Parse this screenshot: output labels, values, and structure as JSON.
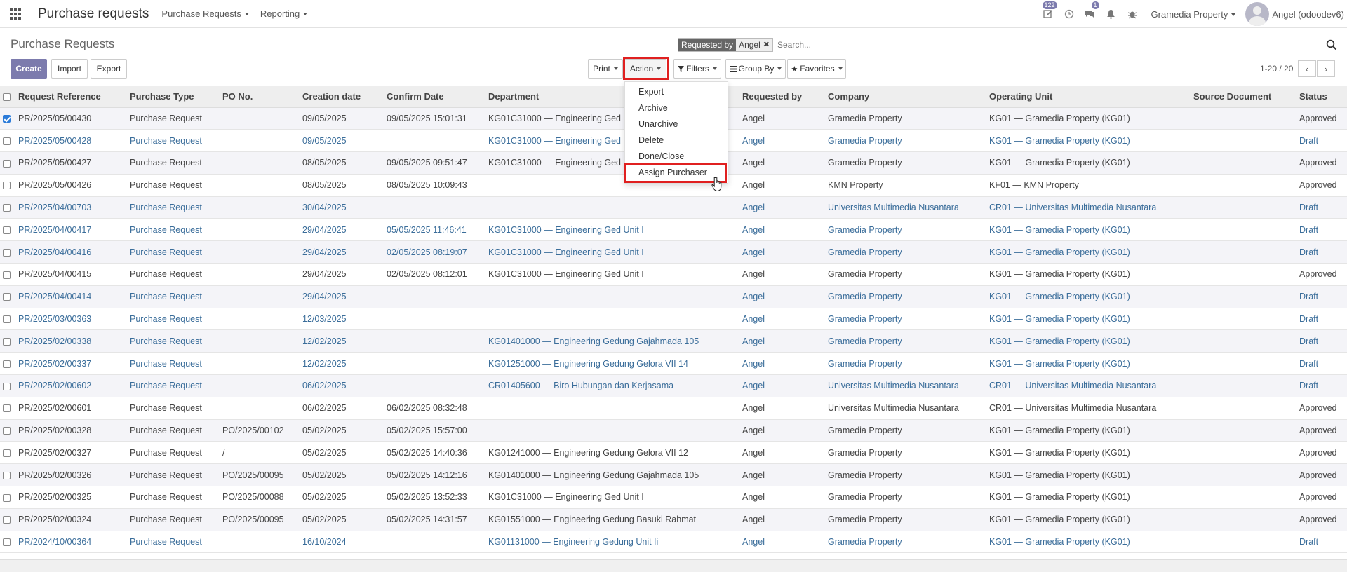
{
  "navbar": {
    "title": "Purchase requests",
    "menus": [
      "Purchase Requests",
      "Reporting"
    ],
    "activity_badge": "122",
    "messages_badge": "1",
    "company": "Gramedia Property",
    "user": "Angel (odoodev6)"
  },
  "control_panel": {
    "title": "Purchase Requests",
    "create_label": "Create",
    "import_label": "Import",
    "export_label": "Export",
    "print_label": "Print",
    "action_label": "Action",
    "filters_label": "Filters",
    "group_by_label": "Group By",
    "favorites_label": "Favorites",
    "search_facet_label": "Requested by",
    "search_facet_value": "Angel",
    "search_placeholder": "Search...",
    "pager": "1-20 / 20"
  },
  "action_menu": [
    "Export",
    "Archive",
    "Unarchive",
    "Delete",
    "Done/Close",
    "Assign Purchaser"
  ],
  "table": {
    "columns": [
      "Request Reference",
      "Purchase Type",
      "PO No.",
      "Creation date",
      "Confirm Date",
      "Department",
      "Requested by",
      "Company",
      "Operating Unit",
      "Source Document",
      "Status"
    ],
    "rows": [
      {
        "checked": true,
        "status_class": "approved",
        "cells": [
          "PR/2025/05/00430",
          "Purchase Request",
          "",
          "09/05/2025",
          "09/05/2025 15:01:31",
          "KG01C31000 — Engineering Ged Unit I",
          "Angel",
          "Gramedia Property",
          "KG01 — Gramedia Property (KG01)",
          "",
          "Approved"
        ]
      },
      {
        "checked": false,
        "status_class": "draft",
        "cells": [
          "PR/2025/05/00428",
          "Purchase Request",
          "",
          "09/05/2025",
          "",
          "KG01C31000 — Engineering Ged Unit I",
          "Angel",
          "Gramedia Property",
          "KG01 — Gramedia Property (KG01)",
          "",
          "Draft"
        ]
      },
      {
        "checked": false,
        "status_class": "approved",
        "cells": [
          "PR/2025/05/00427",
          "Purchase Request",
          "",
          "08/05/2025",
          "09/05/2025 09:51:47",
          "KG01C31000 — Engineering Ged Unit I",
          "Angel",
          "Gramedia Property",
          "KG01 — Gramedia Property (KG01)",
          "",
          "Approved"
        ]
      },
      {
        "checked": false,
        "status_class": "approved",
        "cells": [
          "PR/2025/05/00426",
          "Purchase Request",
          "",
          "08/05/2025",
          "08/05/2025 10:09:43",
          "",
          "Angel",
          "KMN Property",
          "KF01 — KMN Property",
          "",
          "Approved"
        ]
      },
      {
        "checked": false,
        "status_class": "draft",
        "cells": [
          "PR/2025/04/00703",
          "Purchase Request",
          "",
          "30/04/2025",
          "",
          "",
          "Angel",
          "Universitas Multimedia Nusantara",
          "CR01 — Universitas Multimedia Nusantara",
          "",
          "Draft"
        ]
      },
      {
        "checked": false,
        "status_class": "draft",
        "cells": [
          "PR/2025/04/00417",
          "Purchase Request",
          "",
          "29/04/2025",
          "05/05/2025 11:46:41",
          "KG01C31000 — Engineering Ged Unit I",
          "Angel",
          "Gramedia Property",
          "KG01 — Gramedia Property (KG01)",
          "",
          "Draft"
        ]
      },
      {
        "checked": false,
        "status_class": "draft",
        "cells": [
          "PR/2025/04/00416",
          "Purchase Request",
          "",
          "29/04/2025",
          "02/05/2025 08:19:07",
          "KG01C31000 — Engineering Ged Unit I",
          "Angel",
          "Gramedia Property",
          "KG01 — Gramedia Property (KG01)",
          "",
          "Draft"
        ]
      },
      {
        "checked": false,
        "status_class": "approved",
        "cells": [
          "PR/2025/04/00415",
          "Purchase Request",
          "",
          "29/04/2025",
          "02/05/2025 08:12:01",
          "KG01C31000 — Engineering Ged Unit I",
          "Angel",
          "Gramedia Property",
          "KG01 — Gramedia Property (KG01)",
          "",
          "Approved"
        ]
      },
      {
        "checked": false,
        "status_class": "draft",
        "cells": [
          "PR/2025/04/00414",
          "Purchase Request",
          "",
          "29/04/2025",
          "",
          "",
          "Angel",
          "Gramedia Property",
          "KG01 — Gramedia Property (KG01)",
          "",
          "Draft"
        ]
      },
      {
        "checked": false,
        "status_class": "draft",
        "cells": [
          "PR/2025/03/00363",
          "Purchase Request",
          "",
          "12/03/2025",
          "",
          "",
          "Angel",
          "Gramedia Property",
          "KG01 — Gramedia Property (KG01)",
          "",
          "Draft"
        ]
      },
      {
        "checked": false,
        "status_class": "draft",
        "cells": [
          "PR/2025/02/00338",
          "Purchase Request",
          "",
          "12/02/2025",
          "",
          "KG01401000 — Engineering Gedung Gajahmada 105",
          "Angel",
          "Gramedia Property",
          "KG01 — Gramedia Property (KG01)",
          "",
          "Draft"
        ]
      },
      {
        "checked": false,
        "status_class": "draft",
        "cells": [
          "PR/2025/02/00337",
          "Purchase Request",
          "",
          "12/02/2025",
          "",
          "KG01251000 — Engineering Gedung Gelora VII 14",
          "Angel",
          "Gramedia Property",
          "KG01 — Gramedia Property (KG01)",
          "",
          "Draft"
        ]
      },
      {
        "checked": false,
        "status_class": "draft",
        "cells": [
          "PR/2025/02/00602",
          "Purchase Request",
          "",
          "06/02/2025",
          "",
          "CR01405600 — Biro Hubungan dan Kerjasama",
          "Angel",
          "Universitas Multimedia Nusantara",
          "CR01 — Universitas Multimedia Nusantara",
          "",
          "Draft"
        ]
      },
      {
        "checked": false,
        "status_class": "approved",
        "cells": [
          "PR/2025/02/00601",
          "Purchase Request",
          "",
          "06/02/2025",
          "06/02/2025 08:32:48",
          "",
          "Angel",
          "Universitas Multimedia Nusantara",
          "CR01 — Universitas Multimedia Nusantara",
          "",
          "Approved"
        ]
      },
      {
        "checked": false,
        "status_class": "approved",
        "cells": [
          "PR/2025/02/00328",
          "Purchase Request",
          "PO/2025/00102",
          "05/02/2025",
          "05/02/2025 15:57:00",
          "",
          "Angel",
          "Gramedia Property",
          "KG01 — Gramedia Property (KG01)",
          "",
          "Approved"
        ]
      },
      {
        "checked": false,
        "status_class": "approved",
        "cells": [
          "PR/2025/02/00327",
          "Purchase Request",
          "/",
          "05/02/2025",
          "05/02/2025 14:40:36",
          "KG01241000 — Engineering Gedung Gelora VII 12",
          "Angel",
          "Gramedia Property",
          "KG01 — Gramedia Property (KG01)",
          "",
          "Approved"
        ]
      },
      {
        "checked": false,
        "status_class": "approved",
        "cells": [
          "PR/2025/02/00326",
          "Purchase Request",
          "PO/2025/00095",
          "05/02/2025",
          "05/02/2025 14:12:16",
          "KG01401000 — Engineering Gedung Gajahmada 105",
          "Angel",
          "Gramedia Property",
          "KG01 — Gramedia Property (KG01)",
          "",
          "Approved"
        ]
      },
      {
        "checked": false,
        "status_class": "approved",
        "cells": [
          "PR/2025/02/00325",
          "Purchase Request",
          "PO/2025/00088",
          "05/02/2025",
          "05/02/2025 13:52:33",
          "KG01C31000 — Engineering Ged Unit I",
          "Angel",
          "Gramedia Property",
          "KG01 — Gramedia Property (KG01)",
          "",
          "Approved"
        ]
      },
      {
        "checked": false,
        "status_class": "approved",
        "cells": [
          "PR/2025/02/00324",
          "Purchase Request",
          "PO/2025/00095",
          "05/02/2025",
          "05/02/2025 14:31:57",
          "KG01551000 — Engineering Gedung Basuki Rahmat",
          "Angel",
          "Gramedia Property",
          "KG01 — Gramedia Property (KG01)",
          "",
          "Approved"
        ]
      },
      {
        "checked": false,
        "status_class": "draft",
        "cells": [
          "PR/2024/10/00364",
          "Purchase Request",
          "",
          "16/10/2024",
          "",
          "KG01131000 — Engineering Gedung Unit Ii",
          "Angel",
          "Gramedia Property",
          "KG01 — Gramedia Property (KG01)",
          "",
          "Draft"
        ]
      }
    ]
  }
}
